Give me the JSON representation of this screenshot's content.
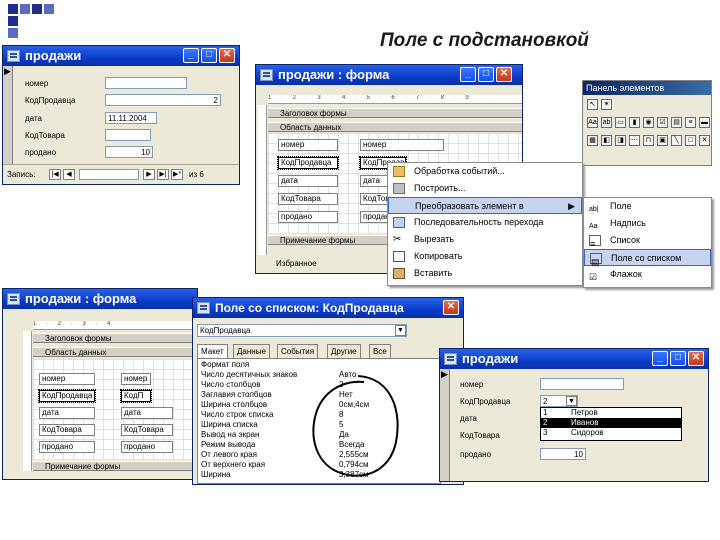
{
  "slide_title": "Поле с подстановкой",
  "win1": {
    "title": "продажи",
    "fields": [
      {
        "label": "номер",
        "value": ""
      },
      {
        "label": "КодПродавца",
        "value": "2"
      },
      {
        "label": "дата",
        "value": "11.11.2004"
      },
      {
        "label": "КодТовара",
        "value": ""
      },
      {
        "label": "продано",
        "value": "10"
      }
    ],
    "record_label": "Запись:",
    "record_of": "из 6"
  },
  "win2": {
    "title": "продажи : форма",
    "ruler": "1 · 2 · 3 · 4 · 5 · 6 · 7 · 8 · 9",
    "header_section": "Заголовок формы",
    "detail_section": "Область данных",
    "footer_section": "Примечание формы",
    "rows": [
      {
        "label": "номер",
        "ctl": "номер"
      },
      {
        "label": "КодПродавца",
        "ctl": "КодПродавца"
      },
      {
        "label": "дата",
        "ctl": "дата"
      },
      {
        "label": "КодТовара",
        "ctl": "КодТовара"
      },
      {
        "label": "продано",
        "ctl": "продано"
      }
    ],
    "bottom_label": "Избранное"
  },
  "toolbox": {
    "title": "Панель элементов"
  },
  "context_menu": {
    "items": [
      "Обработка событий...",
      "Построить...",
      "Преобразовать элемент в",
      "Последовательность перехода",
      "Вырезать",
      "Копировать",
      "Вставить"
    ]
  },
  "submenu": {
    "items": [
      "Поле",
      "Надпись",
      "Список",
      "Поле со списком",
      "Флажок"
    ]
  },
  "win3": {
    "title": "продажи : форма",
    "header_section": "Заголовок формы",
    "detail_section": "Область данных",
    "footer_section": "Примечание формы",
    "rows": [
      {
        "label": "номер",
        "ctl": "номер"
      },
      {
        "label": "КодПродавца",
        "ctl": "КодП"
      },
      {
        "label": "дата",
        "ctl": "дата"
      },
      {
        "label": "КодТовара",
        "ctl": "КодТовара"
      },
      {
        "label": "продано",
        "ctl": "продано"
      }
    ]
  },
  "win4": {
    "title": "Поле со списком: КодПродавца",
    "selector": "КодПродавца",
    "tabs": [
      "Макет",
      "Данные",
      "События",
      "Другие",
      "Все"
    ],
    "props": [
      {
        "name": "Формат поля",
        "value": ""
      },
      {
        "name": "Число десятичных знаков",
        "value": "Авто"
      },
      {
        "name": "Число столбцов",
        "value": "2"
      },
      {
        "name": "Заглавия столбцов",
        "value": "Нет"
      },
      {
        "name": "Ширина столбцов",
        "value": "0см;4см"
      },
      {
        "name": "Число строк списка",
        "value": "8"
      },
      {
        "name": "Ширина списка",
        "value": "5"
      },
      {
        "name": "Вывод на экран",
        "value": "Да"
      },
      {
        "name": "Режим вывода",
        "value": "Всегда"
      },
      {
        "name": "От левого края",
        "value": "2,555см"
      },
      {
        "name": "От верхнего края",
        "value": "0,794см"
      },
      {
        "name": "Ширина",
        "value": "3,387см"
      }
    ]
  },
  "win5": {
    "title": "продажи",
    "fields": [
      {
        "label": "номер",
        "value": ""
      },
      {
        "label": "КодПродавца",
        "value": "2"
      },
      {
        "label": "дата",
        "value": ""
      },
      {
        "label": "КодТовара",
        "value": ""
      },
      {
        "label": "продано",
        "value": "10"
      }
    ],
    "dropdown": [
      {
        "id": "1",
        "name": "Петров"
      },
      {
        "id": "2",
        "name": "Иванов"
      },
      {
        "id": "3",
        "name": "Сидоров"
      }
    ]
  }
}
